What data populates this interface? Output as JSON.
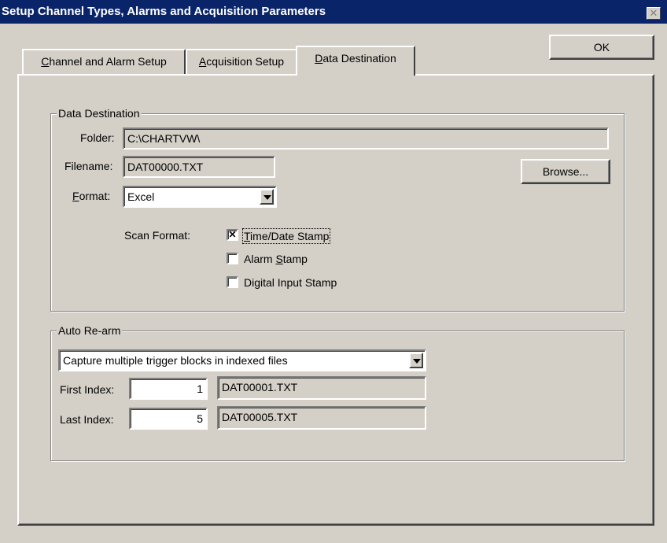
{
  "window": {
    "title": "Setup Channel Types, Alarms and Acquisition Parameters",
    "close_label": "✕"
  },
  "ok_button": "OK",
  "tabs": [
    {
      "pre": "",
      "key": "C",
      "post": "hannel and Alarm Setup"
    },
    {
      "pre": "",
      "key": "A",
      "post": "cquisition Setup"
    },
    {
      "pre": "",
      "key": "D",
      "post": "ata Destination"
    }
  ],
  "data_destination": {
    "group_title": "Data Destination",
    "folder_label": "Folder:",
    "folder_value": "C:\\CHARTVW\\",
    "filename_label": "Filename:",
    "filename_value": "DAT00000.TXT",
    "format_label_key": "F",
    "format_label_post": "ormat:",
    "format_value": "Excel",
    "browse_label": "Browse...",
    "scan_format_label": "Scan Format:",
    "options": [
      {
        "pre": "",
        "key": "T",
        "post": "ime/Date Stamp",
        "checked": true
      },
      {
        "pre": "Alarm ",
        "key": "S",
        "post": "tamp",
        "checked": false
      },
      {
        "pre": "Digital Input Stamp",
        "key": "",
        "post": "",
        "checked": false
      }
    ]
  },
  "auto_rearm": {
    "group_title": "Auto Re-arm",
    "mode_value": "Capture multiple trigger blocks in indexed files",
    "first_index_label": "First Index:",
    "first_index_value": "1",
    "first_file": "DAT00001.TXT",
    "last_index_label": "Last Index:",
    "last_index_value": "5",
    "last_file": "DAT00005.TXT"
  },
  "colors": {
    "face": "#d4d0c8",
    "titlebar": "#0a246a"
  }
}
